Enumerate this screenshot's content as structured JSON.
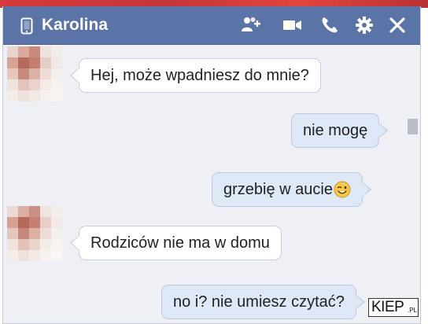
{
  "window": {
    "contact_name": "Karolina",
    "title_bar_color": "#5b73a7",
    "icons": {
      "device": "phone-icon",
      "add_people": "add-person-icon",
      "video_call": "video-icon",
      "voice_call": "call-icon",
      "settings": "gear-icon",
      "close": "close-icon"
    }
  },
  "messages": [
    {
      "direction": "incoming",
      "text": "Hej, może wpadniesz do mnie?"
    },
    {
      "direction": "outgoing",
      "text": "nie mogę"
    },
    {
      "direction": "outgoing",
      "text": "grzebię w aucie",
      "emoji": "winking-smiley-icon"
    },
    {
      "direction": "incoming",
      "text": "Rodziców nie ma w domu"
    },
    {
      "direction": "outgoing",
      "text": "no i? nie umiesz czytać?"
    }
  ],
  "colors": {
    "incoming_bubble": "#ffffff",
    "outgoing_bubble": "#dfe8f7",
    "chat_background": "#eef0f5"
  },
  "watermark": {
    "main": "KIEP",
    "suffix": ".PL"
  }
}
